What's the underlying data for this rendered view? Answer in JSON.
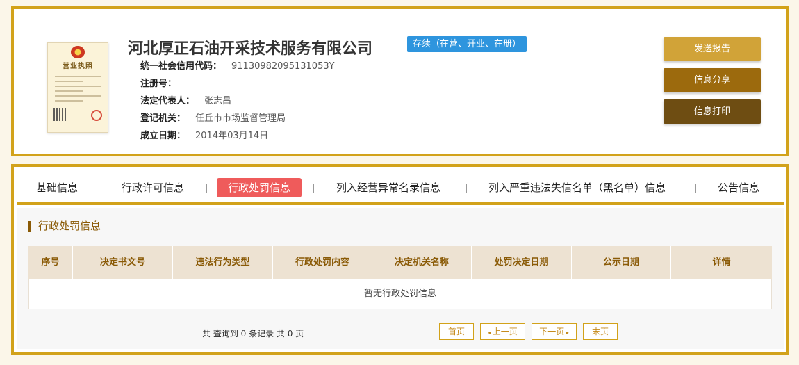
{
  "company": {
    "name": "河北厚正石油开采技术服务有限公司",
    "status": "存续（在营、开业、在册）",
    "license_title": "营业执照",
    "fields": [
      {
        "label": "统一社会信用代码：",
        "value": "91130982095131053Y"
      },
      {
        "label": "注册号：",
        "value": ""
      },
      {
        "label": "法定代表人：",
        "value": "张志昌"
      },
      {
        "label": "登记机关：",
        "value": "任丘市市场监督管理局"
      },
      {
        "label": "成立日期：",
        "value": "2014年03月14日"
      }
    ]
  },
  "actions": {
    "send_report": "发送报告",
    "share_info": "信息分享",
    "print_info": "信息打印"
  },
  "tabs": [
    {
      "label": "基础信息"
    },
    {
      "label": "行政许可信息"
    },
    {
      "label": "行政处罚信息",
      "active": true
    },
    {
      "label": "列入经营异常名录信息"
    },
    {
      "label": "列入严重违法失信名单（黑名单）信息"
    },
    {
      "label": "公告信息"
    }
  ],
  "section": {
    "title": "行政处罚信息",
    "columns": [
      "序号",
      "决定书文号",
      "违法行为类型",
      "行政处罚内容",
      "决定机关名称",
      "处罚决定日期",
      "公示日期",
      "详情"
    ],
    "empty_text": "暂无行政处罚信息"
  },
  "pager": {
    "summary": "共 查询到 0 条记录 共 0 页",
    "first": "首页",
    "prev": "上一页",
    "next": "下一页",
    "last": "末页"
  },
  "colors": {
    "gold_border": "#d2a21a",
    "status_blue": "#2e95de",
    "active_tab": "#ef5b5b",
    "btn_send": "#d1a338",
    "btn_share": "#9c6a0d",
    "btn_print": "#6e4d12"
  }
}
